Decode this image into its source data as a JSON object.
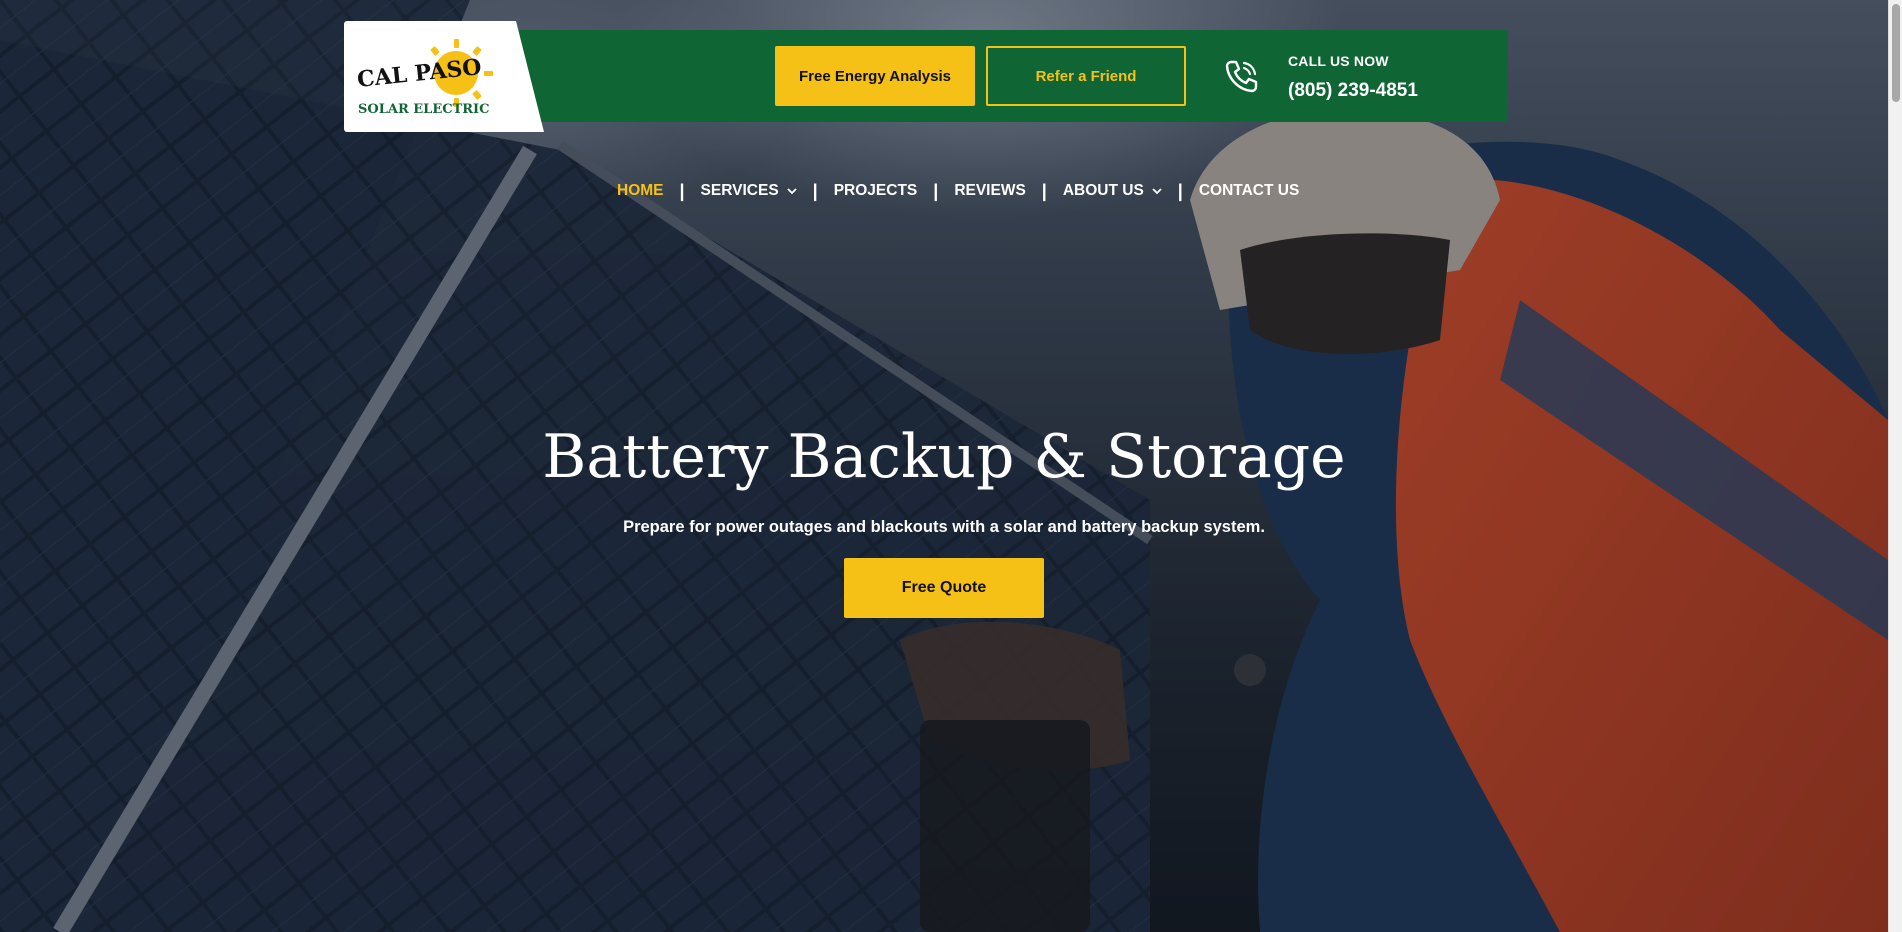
{
  "brand": {
    "logo_line1": "CAL PASO",
    "logo_line2": "SOLAR ELECTRIC",
    "colors": {
      "green": "#0f6533",
      "yellow": "#f5c116",
      "white": "#ffffff"
    }
  },
  "header": {
    "energy_button": "Free Energy Analysis",
    "refer_button": "Refer a Friend",
    "call_label": "CALL US NOW",
    "phone_number": "(805) 239-4851",
    "phone_icon": "phone-ringing-icon"
  },
  "nav": {
    "items": [
      {
        "label": "HOME",
        "active": true,
        "dropdown": false
      },
      {
        "label": "SERVICES",
        "active": false,
        "dropdown": true
      },
      {
        "label": "PROJECTS",
        "active": false,
        "dropdown": false
      },
      {
        "label": "REVIEWS",
        "active": false,
        "dropdown": false
      },
      {
        "label": "ABOUT US",
        "active": false,
        "dropdown": true
      },
      {
        "label": "CONTACT US",
        "active": false,
        "dropdown": false
      }
    ],
    "separator": "|"
  },
  "hero": {
    "title": "Battery Backup & Storage",
    "subtitle": "Prepare for power outages and blackouts with a solar and battery backup system.",
    "cta": "Free Quote"
  }
}
